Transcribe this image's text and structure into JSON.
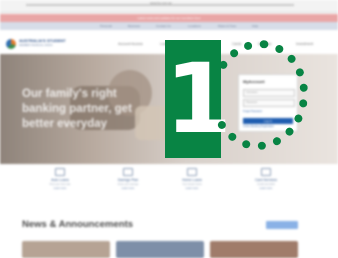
{
  "browser": {
    "address": "www.fcu.com.au"
  },
  "promo": {
    "text": "Latest news and updates for our members here"
  },
  "top_links": [
    "Personal",
    "Business",
    "Contact Us",
    "Locations",
    "Rates & Fees",
    "Help"
  ],
  "brand": {
    "name": "AUSTRALIA'S STUDENT",
    "tagline": "MEMBER FINANCIAL UNION"
  },
  "nav": [
    "Account Access",
    "Loans",
    "Cards",
    "Services",
    "Investment"
  ],
  "hero": {
    "headline": "Our family's right banking partner, get better everyday"
  },
  "login": {
    "title": "MyAccount",
    "username_placeholder": "Username",
    "password_placeholder": "Password",
    "forgot_link": "Forgot Password",
    "submit_label": "Log In",
    "register_link": "Online Banking Registration"
  },
  "features": [
    {
      "title": "Auto Loans",
      "desc": "Find your best rate",
      "link": "Learn more"
    },
    {
      "title": "Savings Plan",
      "desc": "Grow your savings",
      "link": "Learn more"
    },
    {
      "title": "Home Loans",
      "desc": "Your dream home",
      "link": "Learn more"
    },
    {
      "title": "Card Services",
      "desc": "Credit and debit",
      "link": "Learn more"
    }
  ],
  "news": {
    "title": "News & Announcements",
    "button_label": "View all"
  },
  "overlay": {
    "number": "1"
  },
  "colors": {
    "highlight": "#088444",
    "primary": "#1f5db0",
    "brand_blue": "#2b4f88"
  }
}
